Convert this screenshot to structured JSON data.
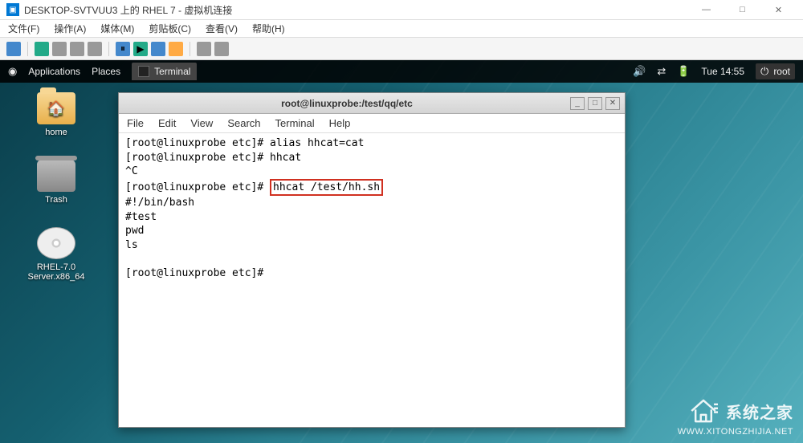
{
  "host": {
    "title": "DESKTOP-SVTVUU3 上的 RHEL 7 - 虚拟机连接",
    "menu": [
      "文件(F)",
      "操作(A)",
      "媒体(M)",
      "剪贴板(C)",
      "查看(V)",
      "帮助(H)"
    ],
    "win_min": "—",
    "win_max": "□",
    "win_close": "✕"
  },
  "gnome": {
    "apps": "Applications",
    "places": "Places",
    "tab": "Terminal",
    "clock": "Tue 14:55",
    "user": "root"
  },
  "desktop": {
    "home": "home",
    "trash": "Trash",
    "disc": "RHEL-7.0 Server.x86_64"
  },
  "terminal": {
    "title": "root@linuxprobe:/test/qq/etc",
    "menu": [
      "File",
      "Edit",
      "View",
      "Search",
      "Terminal",
      "Help"
    ],
    "lines": {
      "l1": "[root@linuxprobe etc]# alias hhcat=cat",
      "l2": "[root@linuxprobe etc]# hhcat",
      "l3": "^C",
      "l4a": "[root@linuxprobe etc]# ",
      "l4b": "hhcat /test/hh.sh",
      "l5": "#!/bin/bash",
      "l6": "#test",
      "l7": "pwd",
      "l8": "ls",
      "l9": "",
      "l10": "[root@linuxprobe etc]# "
    },
    "btn_min": "_",
    "btn_max": "□",
    "btn_close": "✕"
  },
  "watermark": {
    "name": "系统之家",
    "url": "WWW.XITONGZHIJIA.NET"
  }
}
